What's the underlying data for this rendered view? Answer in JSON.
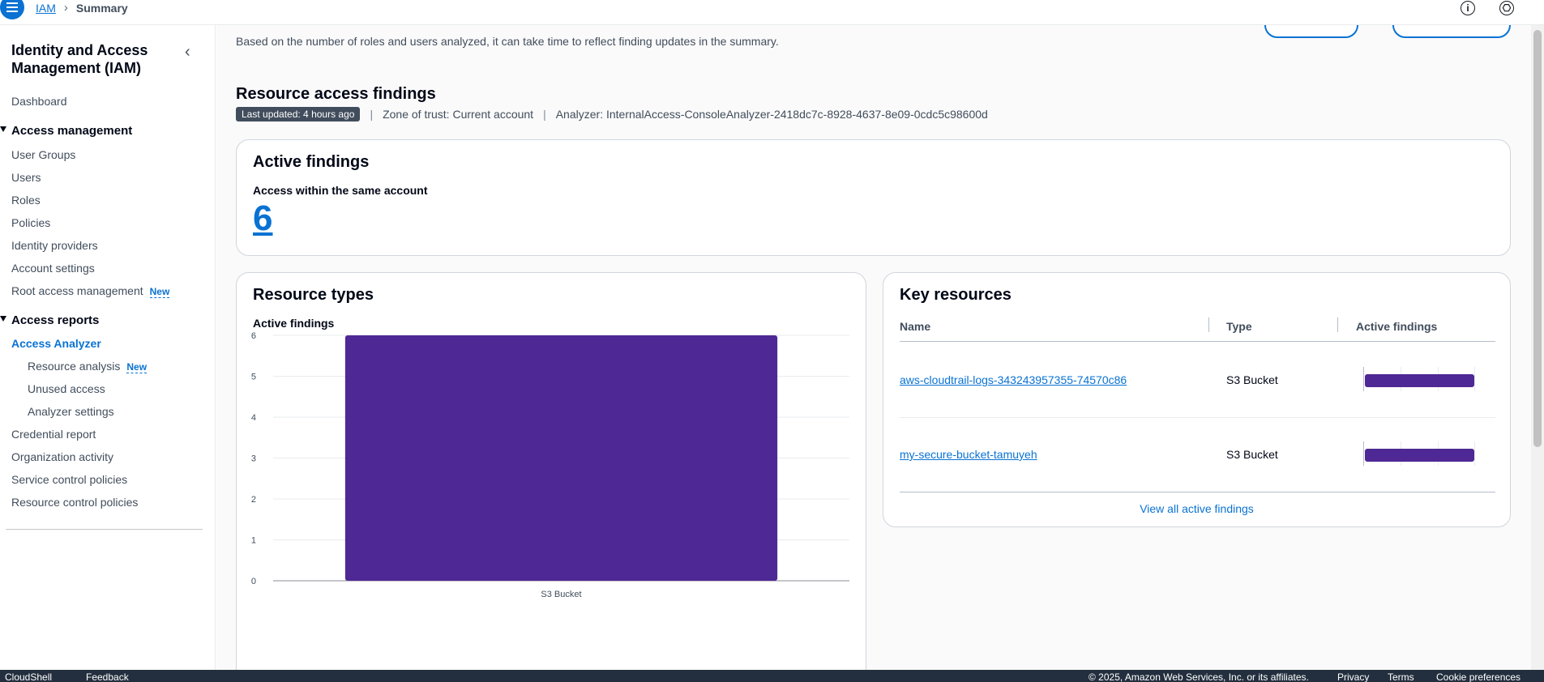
{
  "topbar": {
    "breadcrumbs": [
      "IAM",
      "Summary"
    ],
    "info_icon": "info-icon",
    "settings_icon": "cloudshell-icon"
  },
  "sidebar": {
    "title": "Identity and Access Management (IAM)",
    "dashboard": "Dashboard",
    "access_management": {
      "label": "Access management",
      "items": [
        "User Groups",
        "Users",
        "Roles",
        "Policies",
        "Identity providers",
        "Account settings",
        "Root access management"
      ]
    },
    "new_badge": "New",
    "access_reports": {
      "label": "Access reports",
      "active_item": "Access Analyzer",
      "sub_items": [
        "Resource analysis",
        "Unused access",
        "Analyzer settings"
      ],
      "items": [
        "Credential report",
        "Organization activity",
        "Service control policies",
        "Resource control policies"
      ]
    }
  },
  "main": {
    "subtitle": "Based on the number of roles and users analyzed, it can take time to reflect finding updates in the summary.",
    "section_title": "Resource access findings",
    "last_updated": "Last updated: 4 hours ago",
    "zone_of_trust": "Zone of trust: Current account",
    "analyzer": "Analyzer: InternalAccess-ConsoleAnalyzer-2418dc7c-8928-4637-8e09-0cdc5c98600d",
    "active_findings_card": {
      "title": "Active findings",
      "label": "Access within the same account",
      "count": "6"
    },
    "resource_types_card": {
      "title": "Resource types",
      "label": "Active findings"
    },
    "key_resources_card": {
      "title": "Key resources",
      "columns": [
        "Name",
        "Type",
        "Active findings"
      ],
      "rows": [
        {
          "name": "aws-cloudtrail-logs-343243957355-74570c86",
          "type": "S3 Bucket",
          "findings": 3
        },
        {
          "name": "my-secure-bucket-tamuyeh",
          "type": "S3 Bucket",
          "findings": 3
        }
      ],
      "view_all": "View all active findings"
    }
  },
  "chart_data": {
    "type": "bar",
    "categories": [
      "S3 Bucket"
    ],
    "values": [
      6
    ],
    "ylabel": "Active findings",
    "ylim": [
      0,
      6
    ],
    "yticks": [
      "0",
      "1",
      "2",
      "3",
      "4",
      "5",
      "6"
    ],
    "bar_color": "#4e2894",
    "grid": true
  },
  "footer": {
    "cloudshell": "CloudShell",
    "feedback": "Feedback",
    "copyright": "© 2025, Amazon Web Services, Inc. or its affiliates.",
    "links": [
      "Privacy",
      "Terms",
      "Cookie preferences"
    ]
  }
}
